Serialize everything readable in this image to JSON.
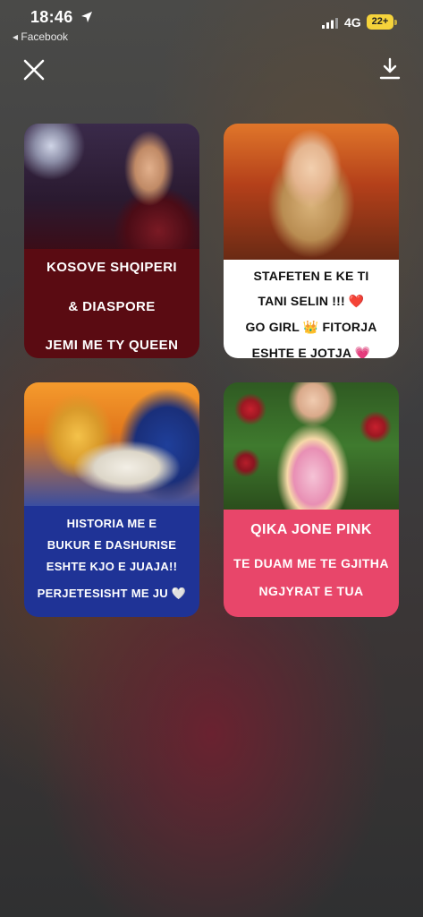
{
  "status_bar": {
    "time": "18:46",
    "back_app": "◂ Facebook",
    "network": "4G",
    "battery": "22+"
  },
  "toolbar": {
    "close_icon": "close-icon",
    "download_icon": "download-icon"
  },
  "cards": [
    {
      "lines": [
        "KOSOVE  SHQIPERI",
        "& DIASPORE",
        "JEMI ME TY QUEEN"
      ],
      "bg": "#5a0b12"
    },
    {
      "lines": [
        "STAFETEN E KE TI",
        "TANI SELIN !!! ❤️",
        "GO GIRL 👑 FITORJA",
        "ESHTE  E JOTJA 💗"
      ],
      "bg": "#ffffff"
    },
    {
      "lines": [
        "HISTORIA ME E",
        "BUKUR E DASHURISE",
        "ESHTE KJO  E JUAJA!!",
        "PERJETESISHT ME JU 🤍"
      ],
      "bg": "#1f3396"
    },
    {
      "lines": [
        "QIKA  JONE  PINK",
        "TE DUAM ME TE GJITHA",
        "NGJYRAT E TUA"
      ],
      "bg": "#e8466a"
    }
  ]
}
